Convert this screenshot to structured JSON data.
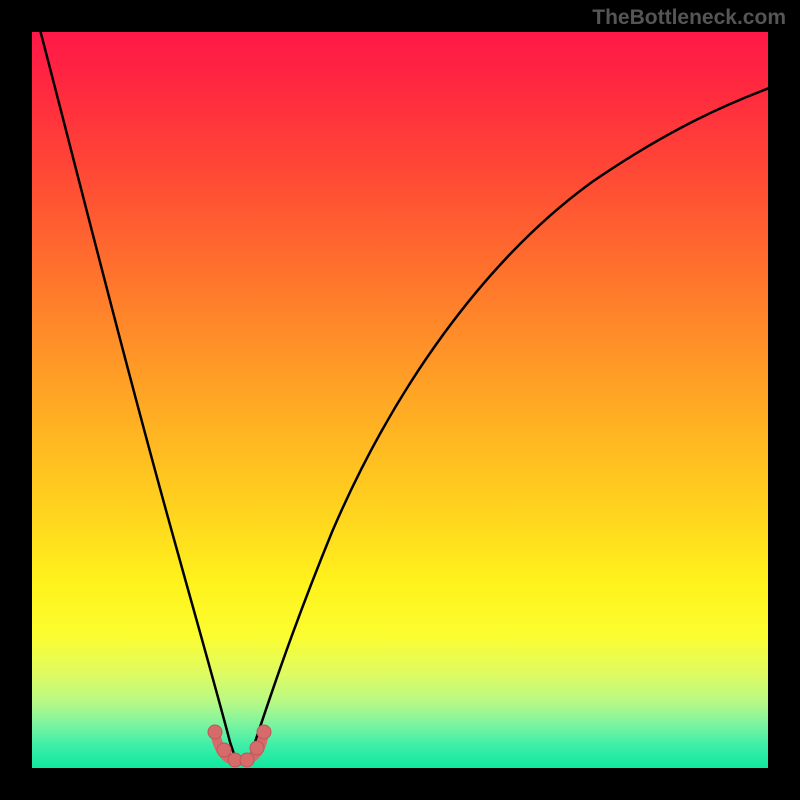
{
  "watermark": "TheBottleneck.com",
  "chart_data": {
    "type": "line",
    "title": "",
    "xlabel": "",
    "ylabel": "",
    "xlim": [
      0,
      100
    ],
    "ylim": [
      0,
      100
    ],
    "background_gradient": {
      "top_color": "#ff1848",
      "bottom_color": "#10e89f",
      "description": "vertical gradient red-orange-yellow-green representing bottleneck severity"
    },
    "series": [
      {
        "name": "left-curve",
        "type": "line",
        "color": "#000000",
        "x": [
          0,
          2,
          4,
          6,
          8,
          10,
          12,
          14,
          16,
          18,
          20,
          22,
          24,
          25.5,
          26.5
        ],
        "y": [
          100,
          90,
          80,
          70.5,
          61.5,
          53,
          45,
          37.5,
          30.5,
          24,
          18,
          12.5,
          7.5,
          4,
          2
        ]
      },
      {
        "name": "right-curve",
        "type": "line",
        "color": "#000000",
        "x": [
          29,
          30,
          32,
          35,
          40,
          46,
          53,
          61,
          70,
          80,
          90,
          100
        ],
        "y": [
          2,
          4,
          9,
          16,
          27,
          38,
          48.5,
          58,
          66.5,
          74,
          80,
          85
        ]
      },
      {
        "name": "minimum-markers",
        "type": "scatter",
        "color": "#d66b6b",
        "x": [
          24.5,
          25.5,
          27,
          28.5,
          30,
          31
        ],
        "y": [
          4.5,
          2.5,
          1,
          1,
          2.5,
          4.5
        ]
      }
    ],
    "annotations": [
      {
        "type": "u-shape",
        "color": "#d66b6b",
        "description": "thick salmon U-shaped marker at curve minimum around x=27"
      }
    ]
  }
}
